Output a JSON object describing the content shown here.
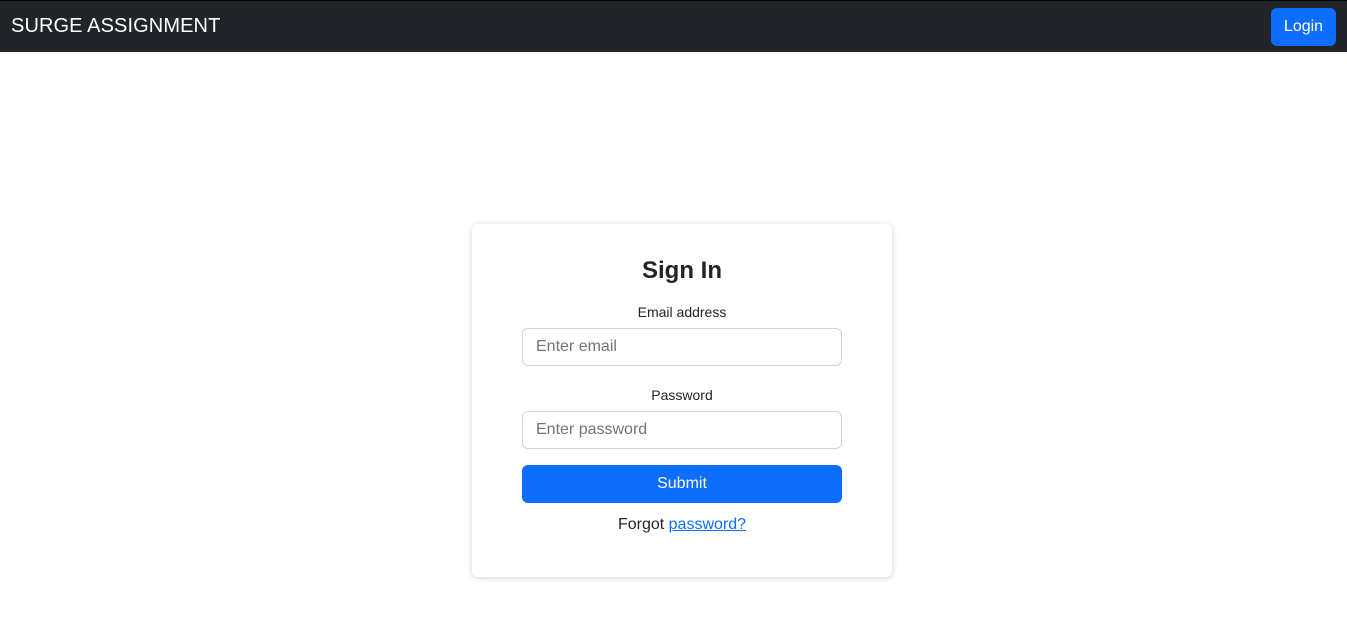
{
  "navbar": {
    "brand": "SURGE ASSIGNMENT",
    "login_label": "Login"
  },
  "signin": {
    "title": "Sign In",
    "email_label": "Email address",
    "email_placeholder": "Enter email",
    "email_value": "",
    "password_label": "Password",
    "password_placeholder": "Enter password",
    "password_value": "",
    "submit_label": "Submit",
    "forgot_text": "Forgot",
    "forgot_link": "password?"
  },
  "colors": {
    "navbar_bg": "#212529",
    "primary": "#0d6efd",
    "text": "#212529",
    "placeholder": "#6c757d",
    "input_border": "#ced4da"
  }
}
